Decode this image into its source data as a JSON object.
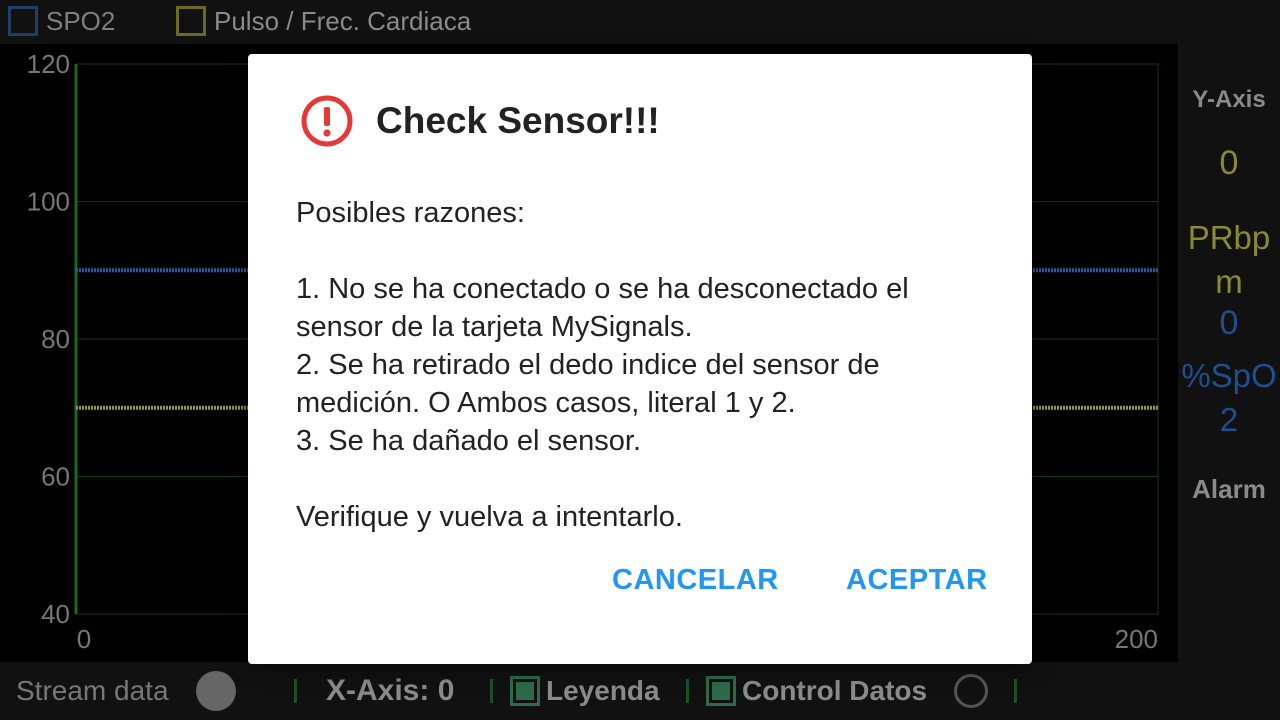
{
  "top_legend": {
    "items": [
      {
        "label": "SPO2",
        "color": "#1f3f66"
      },
      {
        "label": "Pulso / Frec. Cardiaca",
        "color": "#6b6b1f"
      }
    ]
  },
  "chart_data": {
    "type": "line",
    "ylim": [
      40,
      120
    ],
    "xlim": [
      0,
      200
    ],
    "y_ticks": [
      "120",
      "100",
      "80",
      "60",
      "40"
    ],
    "x_ticks": [
      "0",
      "200"
    ],
    "grid": true,
    "series": [
      {
        "name": "SPO2",
        "color": "#1f5fa8",
        "x": [
          0,
          200
        ],
        "y": [
          90,
          90
        ]
      },
      {
        "name": "Pulso / Frec. Cardiaca",
        "color": "#9a9a2a",
        "x": [
          0,
          200
        ],
        "y": [
          70,
          70
        ]
      }
    ]
  },
  "right_panel": {
    "y_axis_label": "Y-Axis",
    "pr_value": "0",
    "pr_unit": "PRbpm",
    "spo2_value": "0",
    "spo2_unit": "%SpO2",
    "alarm_label": "Alarm"
  },
  "bottom_bar": {
    "stream_label": "Stream data",
    "x_axis_label": "X-Axis: 0",
    "leyenda_label": "Leyenda",
    "control_label": "Control Datos"
  },
  "dialog": {
    "title": "Check Sensor!!!",
    "icon": "alert-circle-icon",
    "icon_color": "#e53935",
    "body_intro": "Posibles razones:",
    "reasons": [
      "1. No se ha conectado o se ha desconectado el sensor de la tarjeta MySignals.",
      "2. Se ha retirado el dedo indice del sensor de medición. O Ambos casos, literal 1 y 2.",
      "3. Se ha dañado el sensor."
    ],
    "footer": "Verifique y vuelva a intentarlo.",
    "cancel_label": "CANCELAR",
    "ok_label": "ACEPTAR",
    "button_color": "#2196f3"
  }
}
